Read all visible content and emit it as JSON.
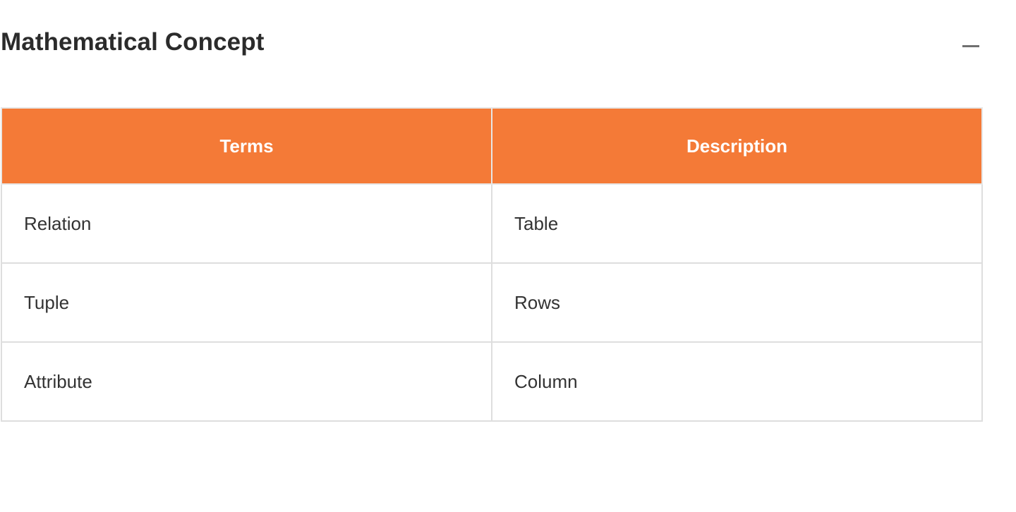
{
  "section": {
    "title": "Mathematical Concept",
    "collapse_icon": "minus-icon"
  },
  "table": {
    "columns": [
      "Terms",
      "Description"
    ],
    "rows": [
      [
        "Relation",
        "Table"
      ],
      [
        "Tuple",
        "Rows"
      ],
      [
        "Attribute",
        "Column"
      ]
    ]
  },
  "colors": {
    "header_background": "#f47a37",
    "header_text": "#ffffff",
    "border": "#dedede",
    "title_text": "#2b2b2b",
    "body_text": "#333333"
  }
}
